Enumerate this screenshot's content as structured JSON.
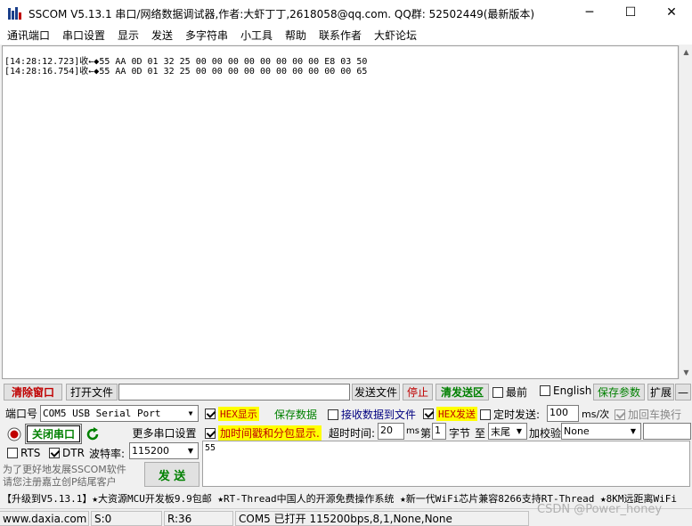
{
  "window": {
    "title": "SSCOM V5.13.1 串口/网络数据调试器,作者:大虾丁丁,2618058@qq.com. QQ群: 52502449(最新版本)",
    "minimize": "─",
    "maximize": "☐",
    "close": "✕"
  },
  "menu": [
    "通讯端口",
    "串口设置",
    "显示",
    "发送",
    "多字符串",
    "小工具",
    "帮助",
    "联系作者",
    "大虾论坛"
  ],
  "receive_lines": [
    "[14:28:12.723]收←◆55 AA 0D 01 32 25 00 00 00 00 00 00 00 00 E8 03 50",
    "[14:28:16.754]收←◆55 AA 0D 01 32 25 00 00 00 00 00 00 00 00 00 00 65"
  ],
  "toolbar": {
    "clear_window": "清除窗口",
    "open_file": "打开文件",
    "file_path": "",
    "send_file": "发送文件",
    "stop": "停止",
    "clear_send": "清发送区",
    "topmost": "最前",
    "english": "English",
    "save_params": "保存参数",
    "expand": "扩展",
    "collapse": "—"
  },
  "port": {
    "port_label": "端口号",
    "port_value": "COM5 USB Serial Port",
    "close_port": "关闭串口",
    "more_settings": "更多串口设置",
    "rts": "RTS",
    "rts_checked": false,
    "dtr": "DTR",
    "dtr_checked": true,
    "baud_label": "波特率:",
    "baud_value": "115200",
    "promo_line1": "为了更好地发展SSCOM软件",
    "promo_line2": "请您注册嘉立创P结尾客户",
    "send": "发 送"
  },
  "options": {
    "hex_display": "HEX显示",
    "hex_display_checked": true,
    "save_data": "保存数据",
    "recv_to_file": "接收数据到文件",
    "recv_to_file_checked": false,
    "hex_send": "HEX发送",
    "hex_send_checked": true,
    "timed_send": "定时发送:",
    "timed_send_checked": false,
    "interval": "100",
    "interval_unit": "ms/次",
    "add_crlf": "加回车换行",
    "add_crlf_checked": true,
    "timestamp": "加时间戳和分包显示.",
    "timestamp_checked": true,
    "timeout_label": "超时时间:",
    "timeout_value": "20",
    "timeout_unit": "ms",
    "nth_label": "第",
    "nth_value": "1",
    "byte_label": "字节",
    "to_label": "至",
    "to_value": "末尾",
    "checksum_label": "加校验",
    "checksum_value": "None"
  },
  "send_text": "55",
  "marquee": "【升级到V5.13.1】★大资源MCU开发板9.9包邮 ★RT-Thread中国人的开源免费操作系统 ★新一代WiFi芯片兼容8266支持RT-Thread ★8KM远距离WiFi",
  "status": {
    "website": "www.daxia.com",
    "sent": "S:0",
    "received": "R:36",
    "port_status": "COM5 已打开  115200bps,8,1,None,None"
  },
  "watermark": "CSDN @Power_honey",
  "colors": {
    "accent_red": "#c00000",
    "accent_green": "#008000",
    "highlight_yellow": "#ffff00"
  }
}
